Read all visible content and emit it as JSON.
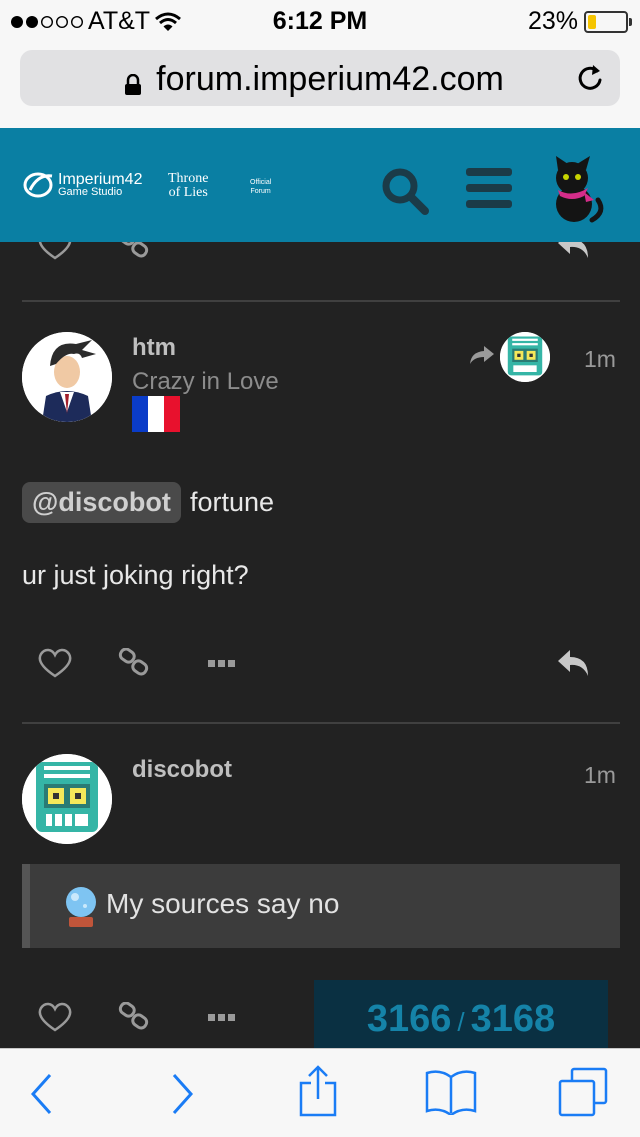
{
  "status_bar": {
    "carrier": "AT&T",
    "time": "6:12 PM",
    "battery": "23%",
    "battery_level": 0.23
  },
  "browser": {
    "url": "forum.imperium42.com"
  },
  "site_header": {
    "brand_name": "Imperium42",
    "brand_sub": "Game Studio",
    "game_logo_line1": "Throne",
    "game_logo_line2": "of Lies",
    "official_line1": "Official",
    "official_line2": "Forum",
    "accent_color": "#0a7fa3"
  },
  "posts": [
    {
      "username": "htm",
      "user_title": "Crazy in Love",
      "flag": "France",
      "time": "1m",
      "mention": "@discobot",
      "mention_rest": "fortune",
      "body": "ur just joking right?",
      "reply_to_avatar": "discobot-avatar"
    },
    {
      "username": "discobot",
      "time": "1m",
      "quote": "My sources say no"
    }
  ],
  "timeline": {
    "current": "3166",
    "separator": "/",
    "total": "3168"
  },
  "icons": [
    "heart-icon",
    "link-icon",
    "more-icon",
    "reply-icon",
    "search-icon",
    "menu-icon",
    "lock-icon",
    "reload-icon",
    "back-icon",
    "forward-icon",
    "share-icon",
    "bookmarks-icon",
    "tabs-icon",
    "crystal-ball-icon"
  ]
}
